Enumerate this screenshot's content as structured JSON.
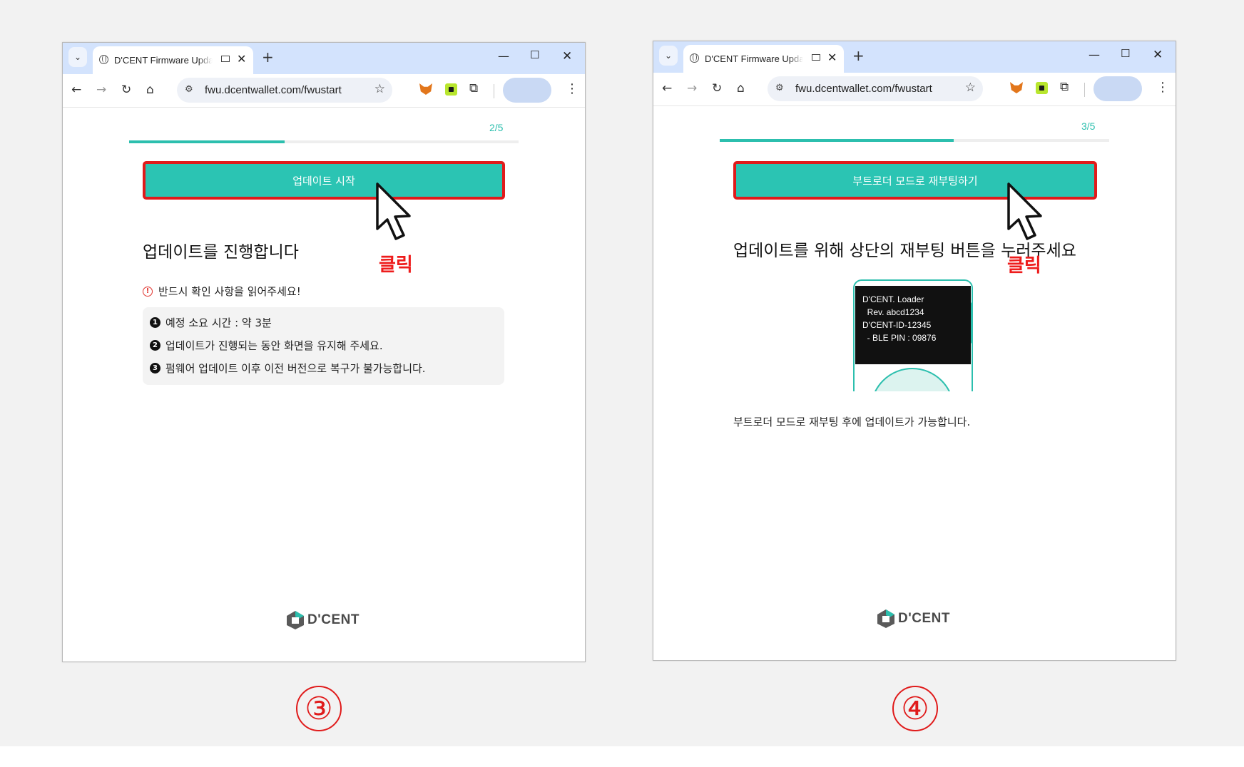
{
  "panels": [
    {
      "tab_title": "D'CENT Firmware Update",
      "url": "fwu.dcentwallet.com/fwustart",
      "step": "2/5",
      "progress": 0.4,
      "button_label": "업데이트 시작",
      "click_label": "클릭",
      "heading": "업데이트를 진행합니다",
      "warning": "반드시 확인 사항을 읽어주세요!",
      "items": [
        {
          "num": "1",
          "text": "예정 소요 시간 : 약 3분"
        },
        {
          "num": "2",
          "text": "업데이트가 진행되는 동안 화면을 유지해 주세요."
        },
        {
          "num": "3",
          "text": "펌웨어 업데이트 이후 이전 버전으로 복구가 불가능합니다."
        }
      ],
      "logo": "D'CENT",
      "marker": "③"
    },
    {
      "tab_title": "D'CENT Firmware Update",
      "url": "fwu.dcentwallet.com/fwustart",
      "step": "3/5",
      "progress": 0.6,
      "button_label": "부트로더 모드로 재부팅하기",
      "click_label": "클릭",
      "heading": "업데이트를 위해 상단의 재부팅 버튼을 누러주세요",
      "device_screen": [
        "D'CENT. Loader",
        "  Rev. abcd1234",
        "",
        "D'CENT-ID-12345",
        "  - BLE PIN : 09876"
      ],
      "note": "부트로더 모드로 재부팅 후에 업데이트가 가능합니다.",
      "logo": "D'CENT",
      "marker": "④"
    }
  ],
  "browser_icons": [
    "chevron-down-icon",
    "globe-icon",
    "media-icon",
    "close-icon",
    "plus-icon",
    "minimize-icon",
    "maximize-icon",
    "window-close-icon",
    "back-icon",
    "forward-icon",
    "reload-icon",
    "home-icon",
    "site-settings-icon",
    "star-icon",
    "metamask-icon",
    "extension-icon",
    "puzzle-icon",
    "kebab-menu-icon"
  ],
  "colors": {
    "accent": "#2bc4b3",
    "highlight": "#e01b1b",
    "tab_strip": "#d3e3fd"
  }
}
